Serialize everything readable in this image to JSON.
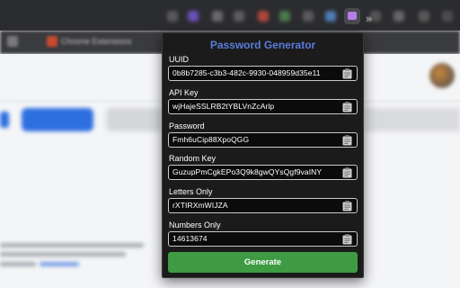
{
  "popup": {
    "title": "Password Generator",
    "fields": [
      {
        "label": "UUID",
        "value": "0b8b7285-c3b3-482c-9930-048959d35e11"
      },
      {
        "label": "API Key",
        "value": "wjHajeSSLRB2tYBLVnZcArlp"
      },
      {
        "label": "Password",
        "value": "Fmh6uCip88XpoQGG"
      },
      {
        "label": "Random Key",
        "value": "GuzupPmCgkEPo3Q9k8gwQYsQgf9vaINY"
      },
      {
        "label": "Letters Only",
        "value": "rXTIRXmWIJZA"
      },
      {
        "label": "Numbers Only",
        "value": "14613674"
      }
    ],
    "generate_label": "Generate",
    "copy_icon": "clipboard-icon"
  },
  "colors": {
    "title": "#5b7bdc",
    "popup_bg": "#1b1b1b",
    "generate_button": "#3e9a43",
    "browser_accent_blue": "#2e6fe0"
  },
  "background": {
    "tab_label": "Chrome Extensions"
  }
}
